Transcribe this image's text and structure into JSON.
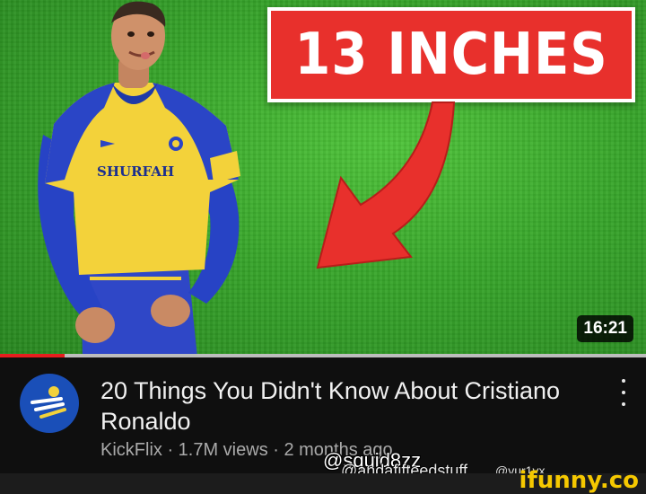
{
  "thumbnail": {
    "banner_text": "13 INCHES",
    "jersey_sponsor": "SHURFAH",
    "duration": "16:21",
    "progress_fraction": 0.1
  },
  "video": {
    "title": "20 Things You Didn't Know About Cristiano Ronaldo",
    "meta": "KickFlix · 1.7M views · 2 months ago"
  },
  "watermarks": {
    "tiktok_handle": "@squid8zz",
    "overlay_handle": "@andafifteedstuff",
    "small_handle": "@vur1vx",
    "site": "ifunny.co"
  },
  "colors": {
    "banner_red": "#e8302c",
    "progress_red": "#e61e1e",
    "ifunny_yellow": "#f5c800",
    "kit_yellow": "#f3d23a",
    "kit_blue": "#2443c6"
  }
}
